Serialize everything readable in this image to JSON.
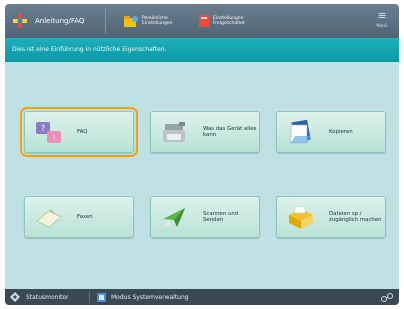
{
  "topbar": {
    "home_title": "Anleitung/FAQ",
    "shortcut1_label": "Persönliche Einstellungen",
    "shortcut2_label": "Einstellungen Freigeschaltet",
    "menu_label": "Menü"
  },
  "info_message": "Dies ist eine Einführung in nützliche Eigenschaften.",
  "buttons": [
    {
      "label": "FAQ"
    },
    {
      "label": "Was das Gerät alles kann"
    },
    {
      "label": "Kopieren"
    },
    {
      "label": "Faxen"
    },
    {
      "label": "Scannen und Senden"
    },
    {
      "label": "Dateien sp./ zugänglich machen"
    }
  ],
  "statusbar": {
    "status_monitor": "Statusmonitor",
    "system_mode": "Modus Systemverwaltung"
  },
  "colors": {
    "selection": "#f0a30a",
    "info_bar": "#14a6b3",
    "button": "#c9eadf"
  }
}
